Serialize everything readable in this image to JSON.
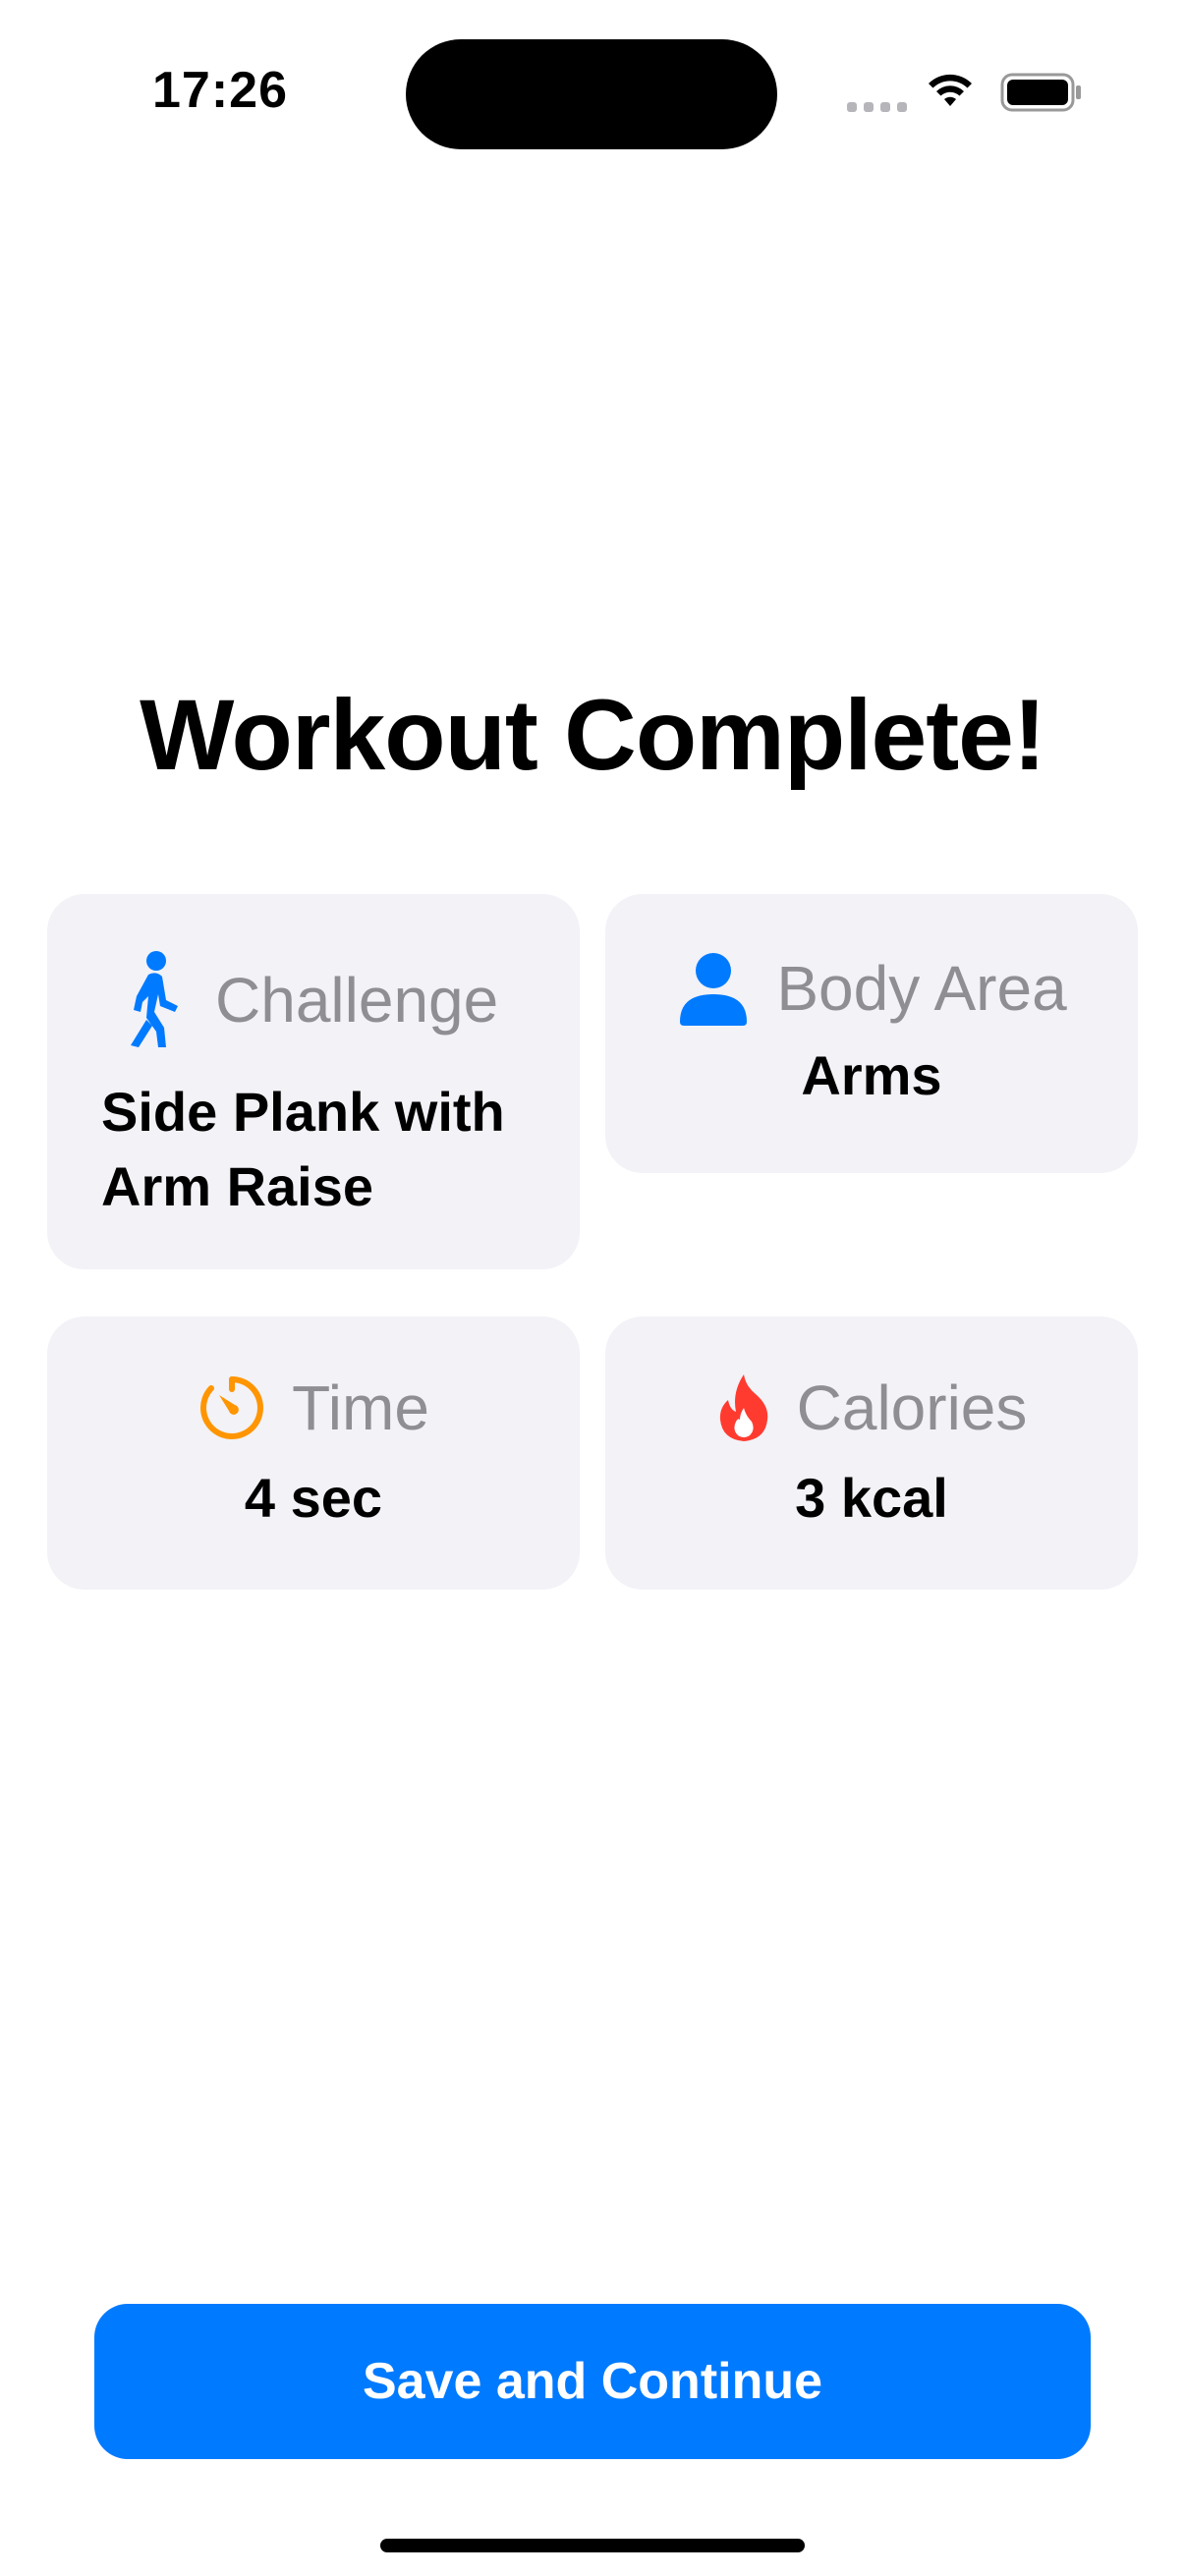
{
  "status_bar": {
    "time": "17:26"
  },
  "title": "Workout Complete!",
  "cards": {
    "challenge": {
      "label": "Challenge",
      "value": "Side Plank with Arm Raise",
      "icon": "walking-figure-icon",
      "icon_color": "#007aff"
    },
    "body_area": {
      "label": "Body Area",
      "value": "Arms",
      "icon": "person-icon",
      "icon_color": "#007aff"
    },
    "time": {
      "label": "Time",
      "value": "4 sec",
      "icon": "timer-icon",
      "icon_color": "#ff9500"
    },
    "calories": {
      "label": "Calories",
      "value": "3 kcal",
      "icon": "flame-icon",
      "icon_color": "#ff3b30"
    }
  },
  "button": {
    "label": "Save and Continue",
    "color": "#007aff"
  }
}
